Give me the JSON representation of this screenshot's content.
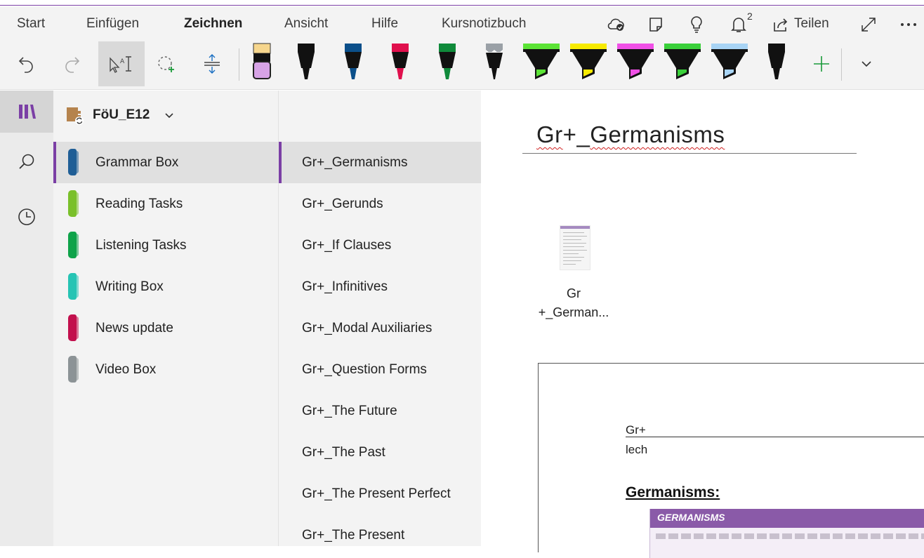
{
  "menu": {
    "items": [
      "Start",
      "Einfügen",
      "Zeichnen",
      "Ansicht",
      "Hilfe",
      "Kursnotizbuch"
    ],
    "active": "Zeichnen",
    "share_label": "Teilen",
    "notification_count": "2"
  },
  "toolbar": {
    "pens": [
      {
        "name": "pen-black-1",
        "body": "#111111",
        "tip": "#111111"
      },
      {
        "name": "pen-blue",
        "body": "#111111",
        "tip": "#0b4f8a"
      },
      {
        "name": "pen-red",
        "body": "#111111",
        "tip": "#e0104d"
      },
      {
        "name": "pen-green",
        "body": "#111111",
        "tip": "#0f8a3a"
      },
      {
        "name": "pen-galaxy",
        "body": "#111111",
        "tip": "#9aa0a6"
      },
      {
        "name": "highlighter-green",
        "body": "#111111",
        "tip": "#5be335"
      },
      {
        "name": "highlighter-yellow",
        "body": "#111111",
        "tip": "#f7ea00"
      },
      {
        "name": "highlighter-pink",
        "body": "#111111",
        "tip": "#f050e6"
      },
      {
        "name": "highlighter-lime",
        "body": "#111111",
        "tip": "#3ad03a"
      },
      {
        "name": "highlighter-lightblue",
        "body": "#111111",
        "tip": "#a8d4f5"
      },
      {
        "name": "pen-black-2",
        "body": "#111111",
        "tip": "#111111"
      }
    ]
  },
  "notebook": {
    "name": "FöU_E12"
  },
  "sections": [
    {
      "label": "Grammar Box",
      "color": "#1f5e96",
      "selected": true
    },
    {
      "label": "Reading Tasks",
      "color": "#7ac02a",
      "selected": false
    },
    {
      "label": "Listening Tasks",
      "color": "#0fa34a",
      "selected": false
    },
    {
      "label": "Writing Box",
      "color": "#26c4b4",
      "selected": false
    },
    {
      "label": "News update",
      "color": "#c2104d",
      "selected": false
    },
    {
      "label": "Video Box",
      "color": "#8c9396",
      "selected": false
    }
  ],
  "pages": [
    {
      "label": "Gr+_Germanisms",
      "selected": true
    },
    {
      "label": "Gr+_Gerunds",
      "selected": false
    },
    {
      "label": "Gr+_If Clauses",
      "selected": false
    },
    {
      "label": "Gr+_Infinitives",
      "selected": false
    },
    {
      "label": "Gr+_Modal Auxiliaries",
      "selected": false
    },
    {
      "label": "Gr+_Question Forms",
      "selected": false
    },
    {
      "label": "Gr+_The Future",
      "selected": false
    },
    {
      "label": "Gr+_The Past",
      "selected": false
    },
    {
      "label": "Gr+_The Present Perfect",
      "selected": false
    },
    {
      "label": "Gr+_The Present",
      "selected": false
    }
  ],
  "page": {
    "title_part1": "Gr",
    "title_part2": "+_",
    "title_part3": "Germanisms",
    "attachment_line1": "Gr",
    "attachment_line2": "+_German...",
    "printout": {
      "gr_label": "Gr+",
      "lech_label": "lech",
      "heading": "Germanisms:",
      "box_title": "GERMANISMS"
    }
  },
  "colors": {
    "accent": "#7b3fa5",
    "panel_bg": "#f3f3f3",
    "selected_bg": "#e0e0e0"
  }
}
